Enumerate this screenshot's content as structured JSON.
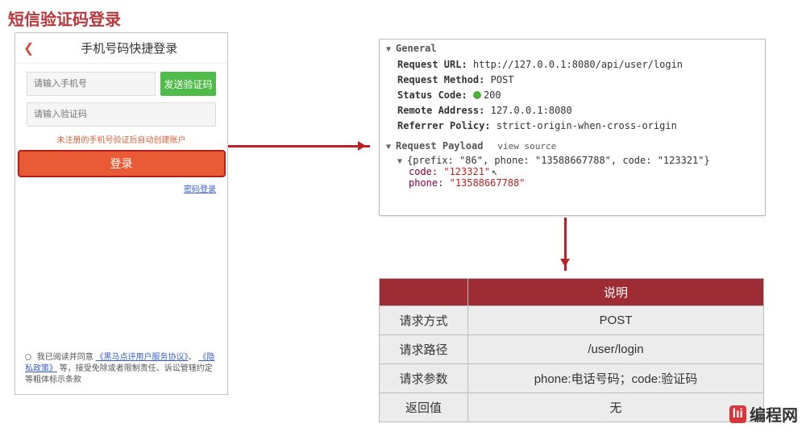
{
  "title": "短信验证码登录",
  "phone_panel": {
    "header": "手机号码快捷登录",
    "phone_placeholder": "请输入手机号",
    "send_btn": "发送验证码",
    "code_placeholder": "请输入验证码",
    "auto_create_hint": "未注册的手机号验证后自动创建账户",
    "login_btn": "登录",
    "password_login": "密码登录",
    "agree_prefix": "我已阅读并同意",
    "service_link": "《黑马点评用户服务协议》",
    "comma": "、",
    "privacy_link": "《隐私政策》",
    "agree_suffix": "等，接受免除或者限制责任、诉讼管辖约定等粗体标示条款"
  },
  "devtools": {
    "general_label": "General",
    "request_url_label": "Request URL:",
    "request_url": "http://127.0.0.1:8080/api/user/login",
    "request_method_label": "Request Method:",
    "request_method": "POST",
    "status_code_label": "Status Code:",
    "status_code": "200",
    "remote_addr_label": "Remote Address:",
    "remote_addr": "127.0.0.1:8080",
    "referrer_label": "Referrer Policy:",
    "referrer": "strict-origin-when-cross-origin",
    "payload_label": "Request Payload",
    "view_source": "view source",
    "payload_inline": "{prefix: \"86\", phone: \"13588667788\", code: \"123321\"}",
    "payload": {
      "code_key": "code:",
      "code_val": "\"123321\"",
      "phone_key": "phone:",
      "phone_val": "\"13588667788\""
    }
  },
  "spec": {
    "col_desc": "说明",
    "rows": {
      "method_label": "请求方式",
      "method_val": "POST",
      "path_label": "请求路径",
      "path_val": "/user/login",
      "param_label": "请求参数",
      "param_val": "phone:电话号码；code:验证码",
      "return_label": "返回值",
      "return_val": "无"
    }
  },
  "logo": {
    "badge": "lıi",
    "text": "编程网"
  }
}
